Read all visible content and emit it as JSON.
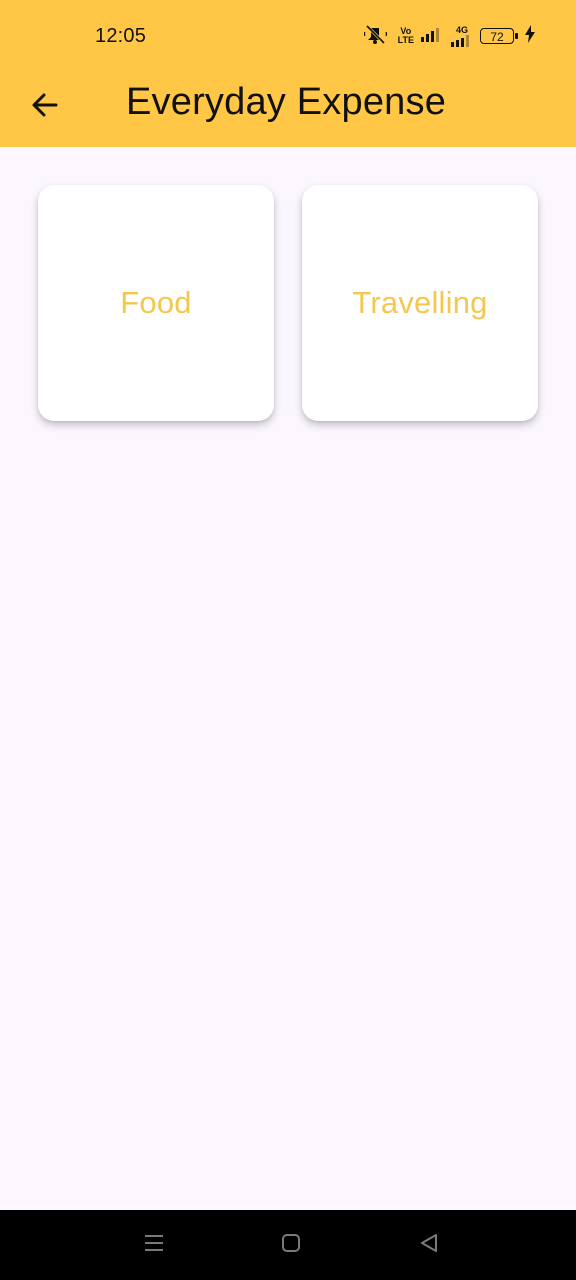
{
  "status_bar": {
    "time": "12:05",
    "network_label": "4G",
    "volte_label_top": "Vo",
    "volte_label_bottom": "LTE",
    "battery": "72",
    "icons": [
      "mute-icon",
      "volte-icon",
      "signal-icon",
      "4g-signal-icon",
      "battery-icon",
      "charging-icon"
    ]
  },
  "app_bar": {
    "title": "Everyday Expense",
    "back_icon": "arrow-left-icon"
  },
  "categories": [
    {
      "label": "Food"
    },
    {
      "label": "Travelling"
    }
  ],
  "nav_bar": {
    "icons": [
      "menu-icon",
      "home-icon",
      "back-icon"
    ]
  },
  "colors": {
    "accent": "#FFC745",
    "card_text": "#F4C84E",
    "background": "#FCF6FE",
    "nav_bar": "#000000"
  }
}
